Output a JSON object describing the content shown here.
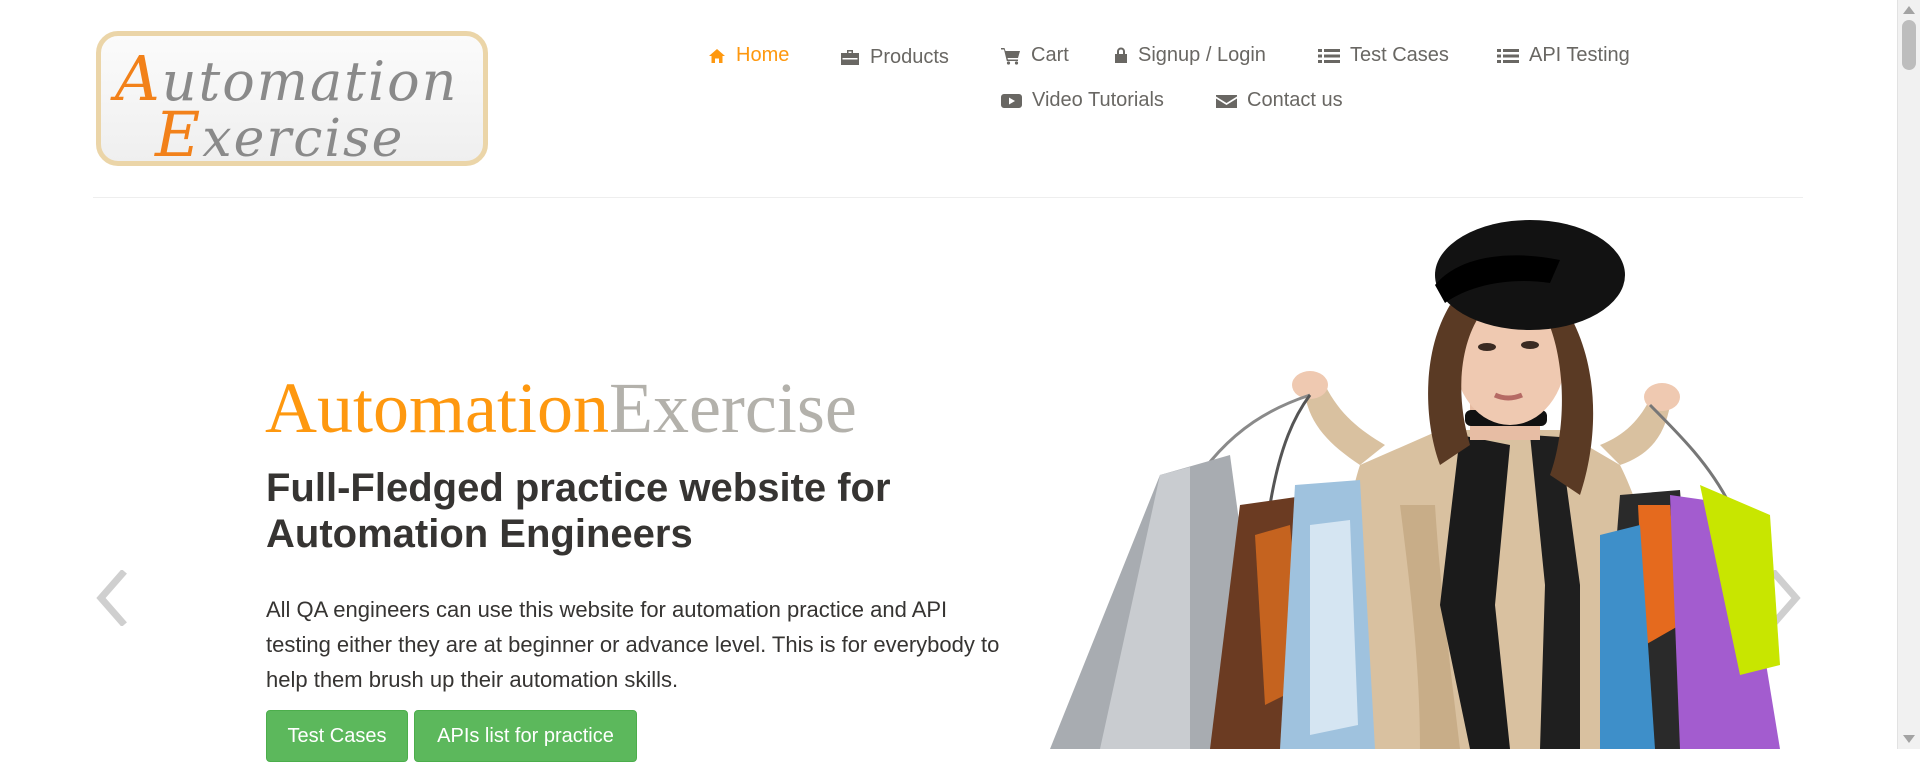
{
  "logo": {
    "line1_cap": "A",
    "line1_rest": "utomation",
    "line2_cap": "E",
    "line2_rest": "xercise"
  },
  "nav": {
    "home": "Home",
    "products": "Products",
    "cart": "Cart",
    "signup_login": "Signup / Login",
    "test_cases": "Test Cases",
    "api_testing": "API Testing",
    "video_tutorials": "Video Tutorials",
    "contact_us": "Contact us"
  },
  "slider": {
    "brand_part1": "Automation",
    "brand_part2": "Exercise",
    "headline": "Full-Fledged practice website for Automation Engineers",
    "description": "All QA engineers can use this website for automation practice and API testing either they are at beginner or advance level. This is for everybody to help them brush up their automation skills.",
    "button_test_cases": "Test Cases",
    "button_apis": "APIs list for practice"
  },
  "colors": {
    "accent": "#fe980f",
    "button": "#5cb85c",
    "text_dark": "#363432",
    "brand_grey": "#b3b1ab"
  },
  "icons": {
    "home": "home-icon",
    "products": "briefcase-icon",
    "cart": "cart-icon",
    "login": "lock-icon",
    "test_cases": "list-icon",
    "api_testing": "list-icon",
    "video": "youtube-play-icon",
    "contact": "envelope-icon",
    "prev": "chevron-left-icon",
    "next": "chevron-right-icon"
  }
}
